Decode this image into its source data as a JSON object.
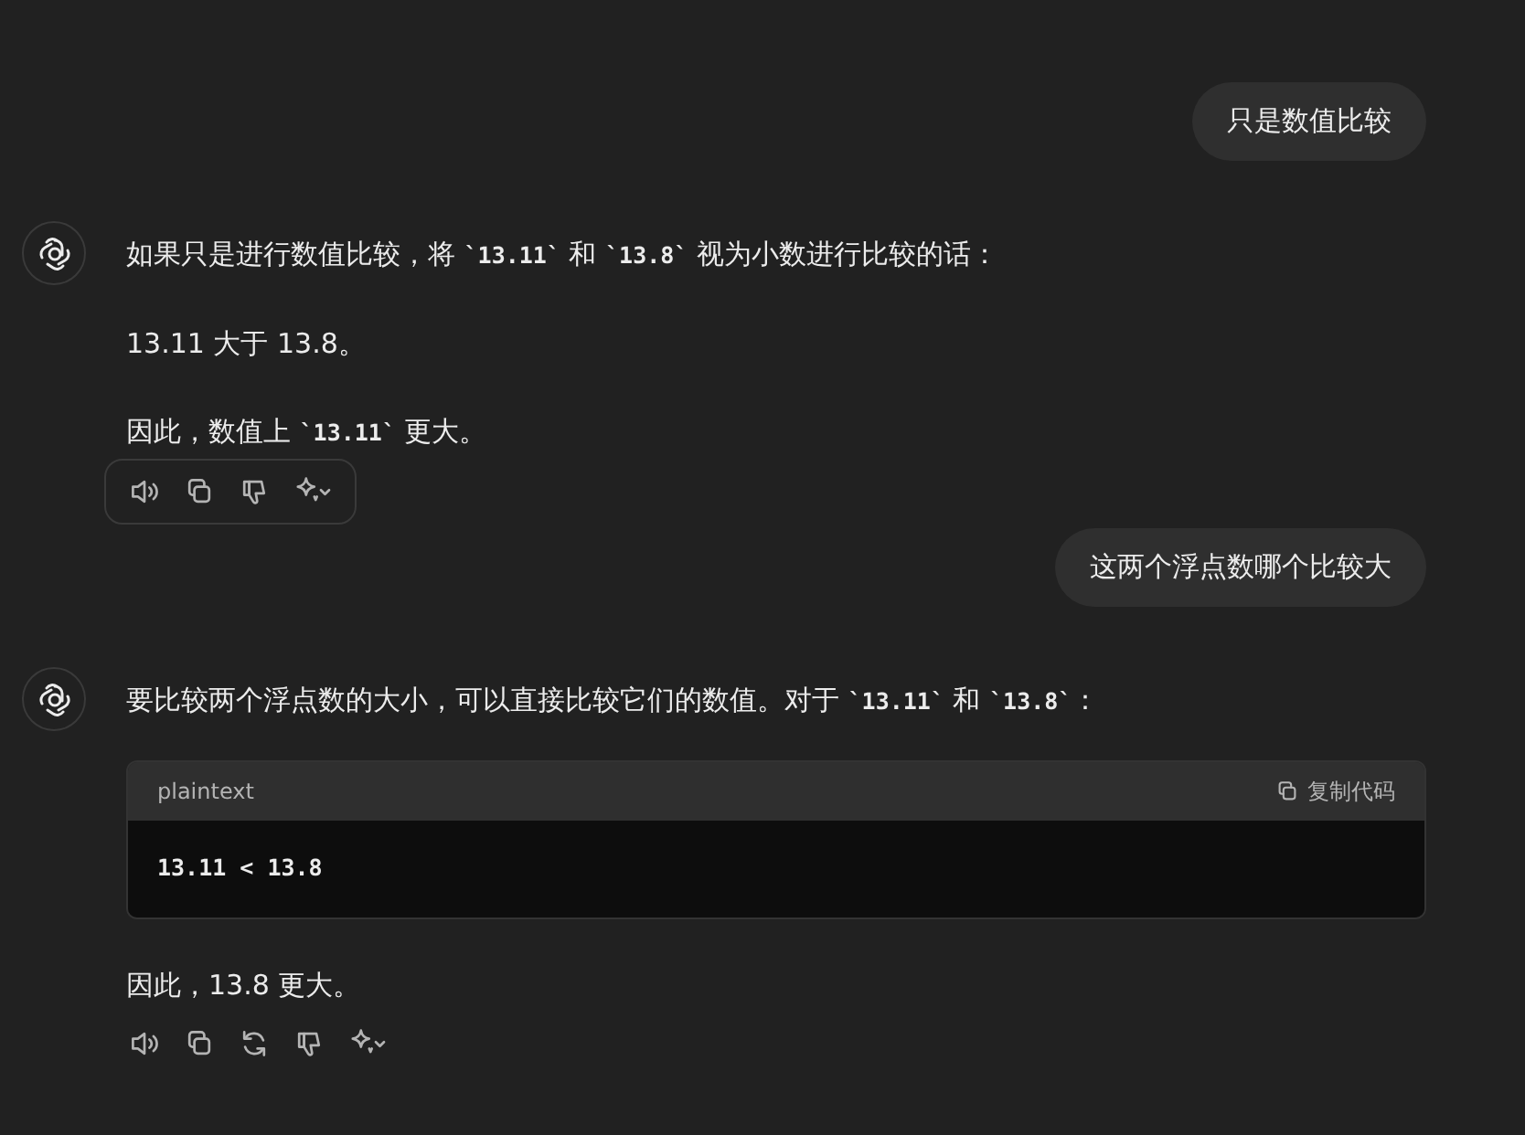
{
  "messages": [
    {
      "kind": "user",
      "text": "只是数值比较"
    },
    {
      "kind": "assistant",
      "blocks": [
        {
          "kind": "paragraph",
          "text": "如果只是进行数值比较，将 **`13.11`** 和 **`13.8`** 视为小数进行比较的话："
        },
        {
          "kind": "paragraph",
          "text": "13.11 大于 13.8。"
        },
        {
          "kind": "paragraph",
          "text": "因此，数值上 **`13.11`** 更大。"
        }
      ],
      "actions": {
        "highlighted": true,
        "items": [
          {
            "kind": "speaker"
          },
          {
            "kind": "copy"
          },
          {
            "kind": "thumbs-down"
          },
          {
            "kind": "sparkle"
          }
        ]
      }
    },
    {
      "kind": "user",
      "text": "这两个浮点数哪个比较大"
    },
    {
      "kind": "assistant",
      "blocks": [
        {
          "kind": "paragraph",
          "text": "要比较两个浮点数的大小，可以直接比较它们的数值。对于 **`13.11`** 和 **`13.8`**："
        },
        {
          "kind": "code",
          "language": "plaintext",
          "copy_label": "复制代码",
          "code": "13.11 < 13.8"
        },
        {
          "kind": "paragraph",
          "text": "因此，13.8 更大。"
        }
      ],
      "actions": {
        "highlighted": false,
        "items": [
          {
            "kind": "speaker"
          },
          {
            "kind": "copy"
          },
          {
            "kind": "refresh"
          },
          {
            "kind": "thumbs-down"
          },
          {
            "kind": "sparkle"
          }
        ]
      }
    }
  ]
}
